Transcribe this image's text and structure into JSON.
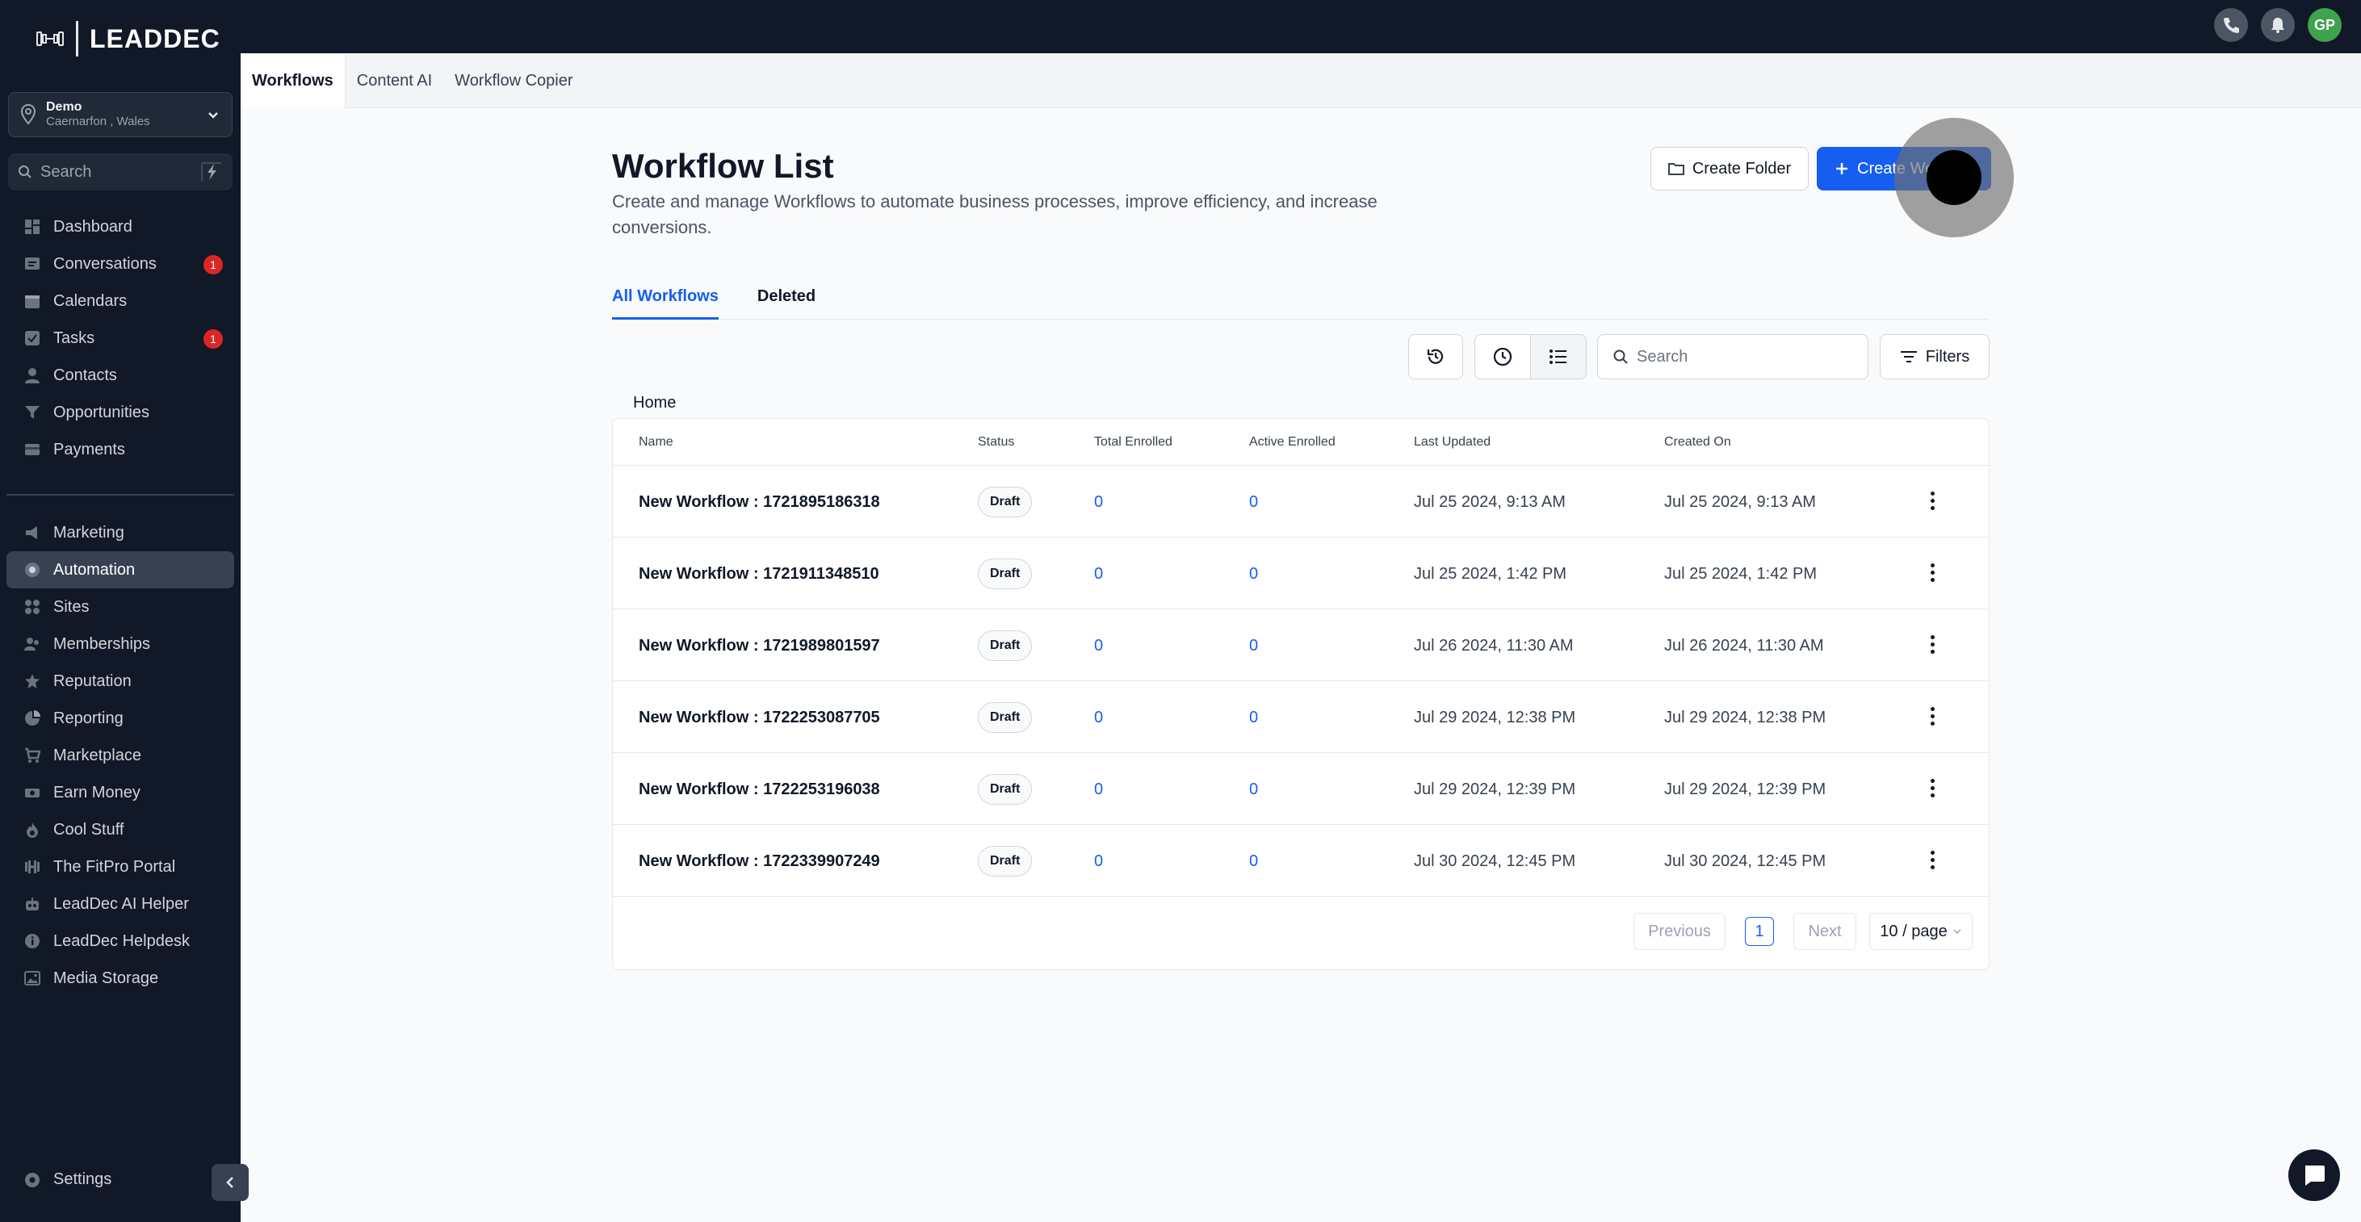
{
  "brand": {
    "name": "LEADDEC"
  },
  "location": {
    "name": "Demo",
    "sub": "Caernarfon , Wales"
  },
  "sidebar_search": {
    "placeholder": "Search"
  },
  "sidebar": {
    "items": [
      {
        "label": "Dashboard",
        "icon": "dashboard-icon"
      },
      {
        "label": "Conversations",
        "icon": "chat-icon",
        "badge": "1"
      },
      {
        "label": "Calendars",
        "icon": "calendar-icon"
      },
      {
        "label": "Tasks",
        "icon": "task-icon",
        "badge": "1"
      },
      {
        "label": "Contacts",
        "icon": "person-icon"
      },
      {
        "label": "Opportunities",
        "icon": "filter-funnel-icon"
      },
      {
        "label": "Payments",
        "icon": "card-icon"
      }
    ],
    "items2": [
      {
        "label": "Marketing",
        "icon": "megaphone-icon"
      },
      {
        "label": "Automation",
        "icon": "automation-icon"
      },
      {
        "label": "Sites",
        "icon": "sites-icon"
      },
      {
        "label": "Memberships",
        "icon": "members-icon"
      },
      {
        "label": "Reputation",
        "icon": "star-icon"
      },
      {
        "label": "Reporting",
        "icon": "pie-icon"
      },
      {
        "label": "Marketplace",
        "icon": "cart-icon"
      },
      {
        "label": "Earn Money",
        "icon": "money-icon"
      },
      {
        "label": "Cool Stuff",
        "icon": "flame-icon"
      },
      {
        "label": "The FitPro Portal",
        "icon": "dumbbell-icon"
      },
      {
        "label": "LeadDec AI Helper",
        "icon": "robot-icon"
      },
      {
        "label": "LeadDec Helpdesk",
        "icon": "info-icon"
      },
      {
        "label": "Media Storage",
        "icon": "image-icon"
      }
    ],
    "settings": "Settings"
  },
  "topbar": {
    "avatar": "GP"
  },
  "tabs": [
    "Workflows",
    "Content AI",
    "Workflow Copier"
  ],
  "page": {
    "title": "Workflow List",
    "description": "Create and manage Workflows to automate business processes, improve efficiency, and increase conversions.",
    "create_folder": "Create Folder",
    "create_workflow": "Create Workflow"
  },
  "subtabs": [
    "All Workflows",
    "Deleted"
  ],
  "search": {
    "placeholder": "Search"
  },
  "filters_label": "Filters",
  "breadcrumb": "Home",
  "table": {
    "columns": [
      "Name",
      "Status",
      "Total Enrolled",
      "Active Enrolled",
      "Last Updated",
      "Created On"
    ],
    "rows": [
      {
        "name": "New Workflow : 1721895186318",
        "status": "Draft",
        "total": "0",
        "active": "0",
        "updated": "Jul 25 2024, 9:13 AM",
        "created": "Jul 25 2024, 9:13 AM"
      },
      {
        "name": "New Workflow : 1721911348510",
        "status": "Draft",
        "total": "0",
        "active": "0",
        "updated": "Jul 25 2024, 1:42 PM",
        "created": "Jul 25 2024, 1:42 PM"
      },
      {
        "name": "New Workflow : 1721989801597",
        "status": "Draft",
        "total": "0",
        "active": "0",
        "updated": "Jul 26 2024, 11:30 AM",
        "created": "Jul 26 2024, 11:30 AM"
      },
      {
        "name": "New Workflow : 1722253087705",
        "status": "Draft",
        "total": "0",
        "active": "0",
        "updated": "Jul 29 2024, 12:38 PM",
        "created": "Jul 29 2024, 12:38 PM"
      },
      {
        "name": "New Workflow : 1722253196038",
        "status": "Draft",
        "total": "0",
        "active": "0",
        "updated": "Jul 29 2024, 12:39 PM",
        "created": "Jul 29 2024, 12:39 PM"
      },
      {
        "name": "New Workflow : 1722339907249",
        "status": "Draft",
        "total": "0",
        "active": "0",
        "updated": "Jul 30 2024, 12:45 PM",
        "created": "Jul 30 2024, 12:45 PM"
      }
    ]
  },
  "pagination": {
    "previous": "Previous",
    "current": "1",
    "next": "Next",
    "per_page": "10 / page"
  },
  "colors": {
    "accent": "#155eef",
    "sidebar_bg": "#111827",
    "badge": "#dc2626"
  }
}
